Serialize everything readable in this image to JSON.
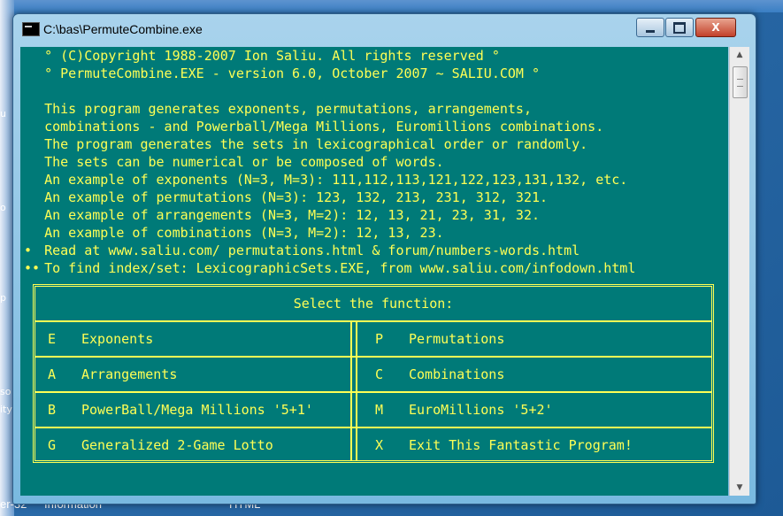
{
  "window": {
    "title": "C:\\bas\\PermuteCombine.exe",
    "minimize_icon": "minimize-icon",
    "maximize_icon": "maximize-icon",
    "close_label": "X"
  },
  "console": {
    "lines": [
      "   ° (C)Copyright 1988-2007 Ion Saliu. All rights reserved °",
      "   ° PermuteCombine.EXE - version 6.0, October 2007 ~ SALIU.COM °",
      "",
      "   This program generates exponents, permutations, arrangements,",
      "   combinations - and Powerball/Mega Millions, Euromillions combinations.",
      "   The program generates the sets in lexicographical order or randomly.",
      "   The sets can be numerical or be composed of words.",
      "   An example of exponents (N=3, M=3): 111,112,113,121,122,123,131,132, etc.",
      "   An example of permutations (N=3): 123, 132, 213, 231, 312, 321.",
      "   An example of arrangements (N=3, M=2): 12, 13, 21, 23, 31, 32.",
      "   An example of combinations (N=3, M=2): 12, 13, 23.",
      "   Read at www.saliu.com/ permutations.html & forum/numbers-words.html",
      "   To find index/set: LexicographicSets.EXE, from www.saliu.com/infodown.html"
    ],
    "bullets": [
      "•",
      "••"
    ]
  },
  "menu": {
    "title": "Select the function:",
    "rows": [
      {
        "left_key": "E",
        "left_label": "Exponents",
        "right_key": "P",
        "right_label": "Permutations"
      },
      {
        "left_key": "A",
        "left_label": "Arrangements",
        "right_key": "C",
        "right_label": "Combinations"
      },
      {
        "left_key": "B",
        "left_label": "PowerBall/Mega Millions '5+1'",
        "right_key": "M",
        "right_label": "EuroMillions '5+2'"
      },
      {
        "left_key": "G",
        "left_label": "Generalized 2-Game Lotto",
        "right_key": "X",
        "right_label": "Exit This Fantastic Program!"
      }
    ]
  },
  "desktop": {
    "left_fragments": [
      "u",
      "o",
      "p",
      "so",
      "ity"
    ],
    "taskbar_labels": [
      "er-32",
      "Information",
      "HTML"
    ]
  },
  "colors": {
    "console_bg": "#007a78",
    "console_text": "#ffff55"
  }
}
